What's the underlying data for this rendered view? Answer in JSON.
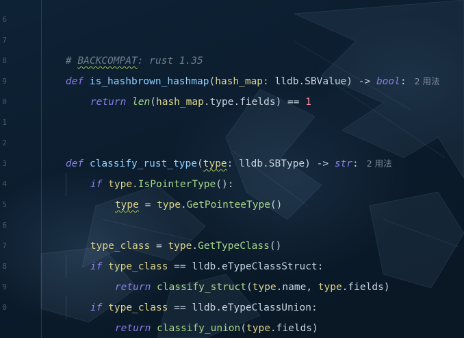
{
  "editor": {
    "gutter_numbers": [
      "6",
      "7",
      "8",
      "9",
      "0",
      "1",
      "2",
      "3",
      "4",
      "5",
      "6",
      "7",
      "8",
      "9",
      "0"
    ],
    "lines": {
      "comment": {
        "hash": "# ",
        "marker": "BACKCOMPAT",
        "rest": ": rust 1.35"
      },
      "def1": {
        "kw": "def",
        "name": "is_hashbrown_hashmap",
        "open": "(",
        "param": "hash_map",
        "colon": ": ",
        "ptype": "lldb.SBValue",
        "close": ") -> ",
        "ret": "bool",
        "end": ":",
        "hint": "2 用法"
      },
      "ret1": {
        "kw": "return",
        "fn": "len",
        "open": "(",
        "param": "hash_map",
        "attrs": ".type.fields",
        "close": ") == ",
        "num": "1"
      },
      "def2": {
        "kw": "def",
        "name": "classify_rust_type",
        "open": "(",
        "param": "type",
        "colon": ": ",
        "ptype": "lldb.SBType",
        "close": ") -> ",
        "ret": "str",
        "end": ":",
        "hint": "2 用法"
      },
      "if1": {
        "kw": "if",
        "param": "type",
        "dot": ".",
        "method": "IsPointerType",
        "end": "():"
      },
      "assign1": {
        "target": "type",
        "eq": " = ",
        "param": "type",
        "dot": ".",
        "method": "GetPointeeType",
        "end": "()"
      },
      "assign2": {
        "target": "type_class",
        "eq": " = ",
        "param": "type",
        "dot": ".",
        "method": "GetTypeClass",
        "end": "()"
      },
      "if2": {
        "kw": "if",
        "target": "type_class",
        "op": " == ",
        "rhs": "lldb.eTypeClassStruct",
        "end": ":"
      },
      "ret2": {
        "kw": "return",
        "fn": "classify_struct",
        "open": "(",
        "param1": "type",
        "attr1": ".name",
        "sep": ", ",
        "param2": "type",
        "attr2": ".fields",
        "end": ")"
      },
      "if3": {
        "kw": "if",
        "target": "type_class",
        "op": " == ",
        "rhs": "lldb.eTypeClassUnion",
        "end": ":"
      },
      "ret3": {
        "kw": "return",
        "fn": "classify_union",
        "open": "(",
        "param": "type",
        "attr": ".fields",
        "end": ")"
      }
    }
  },
  "colors": {
    "keyword": "#8a7fe8",
    "function_name": "#8fd0ff",
    "parameter": "#dcd48a",
    "method": "#a9d98a",
    "number": "#ff8fa3",
    "comment": "#6e7e8e",
    "background": "#0c1d2e"
  }
}
